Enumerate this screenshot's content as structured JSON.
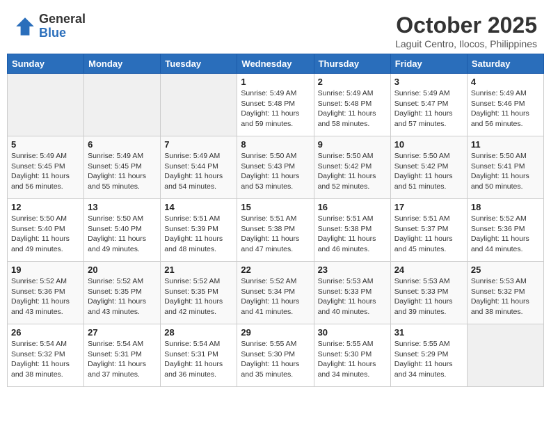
{
  "logo": {
    "general": "General",
    "blue": "Blue"
  },
  "title": "October 2025",
  "subtitle": "Laguit Centro, Ilocos, Philippines",
  "days_of_week": [
    "Sunday",
    "Monday",
    "Tuesday",
    "Wednesday",
    "Thursday",
    "Friday",
    "Saturday"
  ],
  "weeks": [
    [
      {
        "day": "",
        "info": ""
      },
      {
        "day": "",
        "info": ""
      },
      {
        "day": "",
        "info": ""
      },
      {
        "day": "1",
        "info": "Sunrise: 5:49 AM\nSunset: 5:48 PM\nDaylight: 11 hours\nand 59 minutes."
      },
      {
        "day": "2",
        "info": "Sunrise: 5:49 AM\nSunset: 5:48 PM\nDaylight: 11 hours\nand 58 minutes."
      },
      {
        "day": "3",
        "info": "Sunrise: 5:49 AM\nSunset: 5:47 PM\nDaylight: 11 hours\nand 57 minutes."
      },
      {
        "day": "4",
        "info": "Sunrise: 5:49 AM\nSunset: 5:46 PM\nDaylight: 11 hours\nand 56 minutes."
      }
    ],
    [
      {
        "day": "5",
        "info": "Sunrise: 5:49 AM\nSunset: 5:45 PM\nDaylight: 11 hours\nand 56 minutes."
      },
      {
        "day": "6",
        "info": "Sunrise: 5:49 AM\nSunset: 5:45 PM\nDaylight: 11 hours\nand 55 minutes."
      },
      {
        "day": "7",
        "info": "Sunrise: 5:49 AM\nSunset: 5:44 PM\nDaylight: 11 hours\nand 54 minutes."
      },
      {
        "day": "8",
        "info": "Sunrise: 5:50 AM\nSunset: 5:43 PM\nDaylight: 11 hours\nand 53 minutes."
      },
      {
        "day": "9",
        "info": "Sunrise: 5:50 AM\nSunset: 5:42 PM\nDaylight: 11 hours\nand 52 minutes."
      },
      {
        "day": "10",
        "info": "Sunrise: 5:50 AM\nSunset: 5:42 PM\nDaylight: 11 hours\nand 51 minutes."
      },
      {
        "day": "11",
        "info": "Sunrise: 5:50 AM\nSunset: 5:41 PM\nDaylight: 11 hours\nand 50 minutes."
      }
    ],
    [
      {
        "day": "12",
        "info": "Sunrise: 5:50 AM\nSunset: 5:40 PM\nDaylight: 11 hours\nand 49 minutes."
      },
      {
        "day": "13",
        "info": "Sunrise: 5:50 AM\nSunset: 5:40 PM\nDaylight: 11 hours\nand 49 minutes."
      },
      {
        "day": "14",
        "info": "Sunrise: 5:51 AM\nSunset: 5:39 PM\nDaylight: 11 hours\nand 48 minutes."
      },
      {
        "day": "15",
        "info": "Sunrise: 5:51 AM\nSunset: 5:38 PM\nDaylight: 11 hours\nand 47 minutes."
      },
      {
        "day": "16",
        "info": "Sunrise: 5:51 AM\nSunset: 5:38 PM\nDaylight: 11 hours\nand 46 minutes."
      },
      {
        "day": "17",
        "info": "Sunrise: 5:51 AM\nSunset: 5:37 PM\nDaylight: 11 hours\nand 45 minutes."
      },
      {
        "day": "18",
        "info": "Sunrise: 5:52 AM\nSunset: 5:36 PM\nDaylight: 11 hours\nand 44 minutes."
      }
    ],
    [
      {
        "day": "19",
        "info": "Sunrise: 5:52 AM\nSunset: 5:36 PM\nDaylight: 11 hours\nand 43 minutes."
      },
      {
        "day": "20",
        "info": "Sunrise: 5:52 AM\nSunset: 5:35 PM\nDaylight: 11 hours\nand 43 minutes."
      },
      {
        "day": "21",
        "info": "Sunrise: 5:52 AM\nSunset: 5:35 PM\nDaylight: 11 hours\nand 42 minutes."
      },
      {
        "day": "22",
        "info": "Sunrise: 5:52 AM\nSunset: 5:34 PM\nDaylight: 11 hours\nand 41 minutes."
      },
      {
        "day": "23",
        "info": "Sunrise: 5:53 AM\nSunset: 5:33 PM\nDaylight: 11 hours\nand 40 minutes."
      },
      {
        "day": "24",
        "info": "Sunrise: 5:53 AM\nSunset: 5:33 PM\nDaylight: 11 hours\nand 39 minutes."
      },
      {
        "day": "25",
        "info": "Sunrise: 5:53 AM\nSunset: 5:32 PM\nDaylight: 11 hours\nand 38 minutes."
      }
    ],
    [
      {
        "day": "26",
        "info": "Sunrise: 5:54 AM\nSunset: 5:32 PM\nDaylight: 11 hours\nand 38 minutes."
      },
      {
        "day": "27",
        "info": "Sunrise: 5:54 AM\nSunset: 5:31 PM\nDaylight: 11 hours\nand 37 minutes."
      },
      {
        "day": "28",
        "info": "Sunrise: 5:54 AM\nSunset: 5:31 PM\nDaylight: 11 hours\nand 36 minutes."
      },
      {
        "day": "29",
        "info": "Sunrise: 5:55 AM\nSunset: 5:30 PM\nDaylight: 11 hours\nand 35 minutes."
      },
      {
        "day": "30",
        "info": "Sunrise: 5:55 AM\nSunset: 5:30 PM\nDaylight: 11 hours\nand 34 minutes."
      },
      {
        "day": "31",
        "info": "Sunrise: 5:55 AM\nSunset: 5:29 PM\nDaylight: 11 hours\nand 34 minutes."
      },
      {
        "day": "",
        "info": ""
      }
    ]
  ]
}
